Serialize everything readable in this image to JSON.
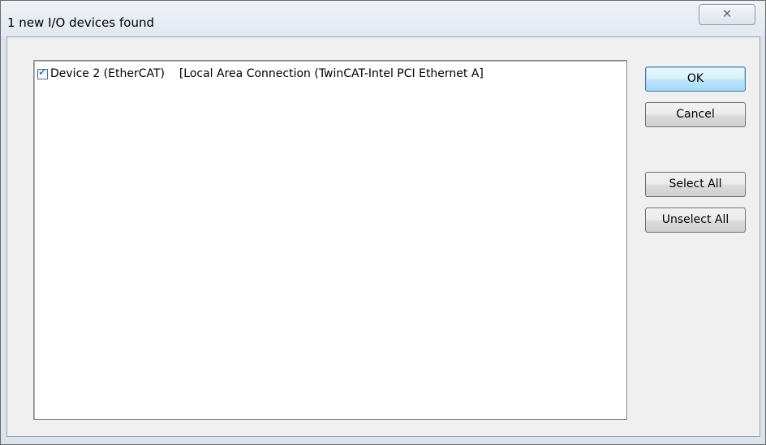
{
  "window": {
    "title": "1 new I/O devices found",
    "close_glyph": "☒"
  },
  "device_list": {
    "items": [
      {
        "checked": true,
        "name": "Device 2 (EtherCAT)",
        "connection": "[Local Area Connection (TwinCAT-Intel PCI Ethernet A]"
      }
    ]
  },
  "buttons": {
    "ok": "OK",
    "cancel": "Cancel",
    "select_all": "Select All",
    "unselect_all": "Unselect All"
  },
  "colors": {
    "title_bar": "#e2e9f2",
    "client_area": "#f0f0f0",
    "default_button": "#bee6fd"
  },
  "icons": {
    "close": "close-icon",
    "checkbox": "checkmark-icon"
  }
}
